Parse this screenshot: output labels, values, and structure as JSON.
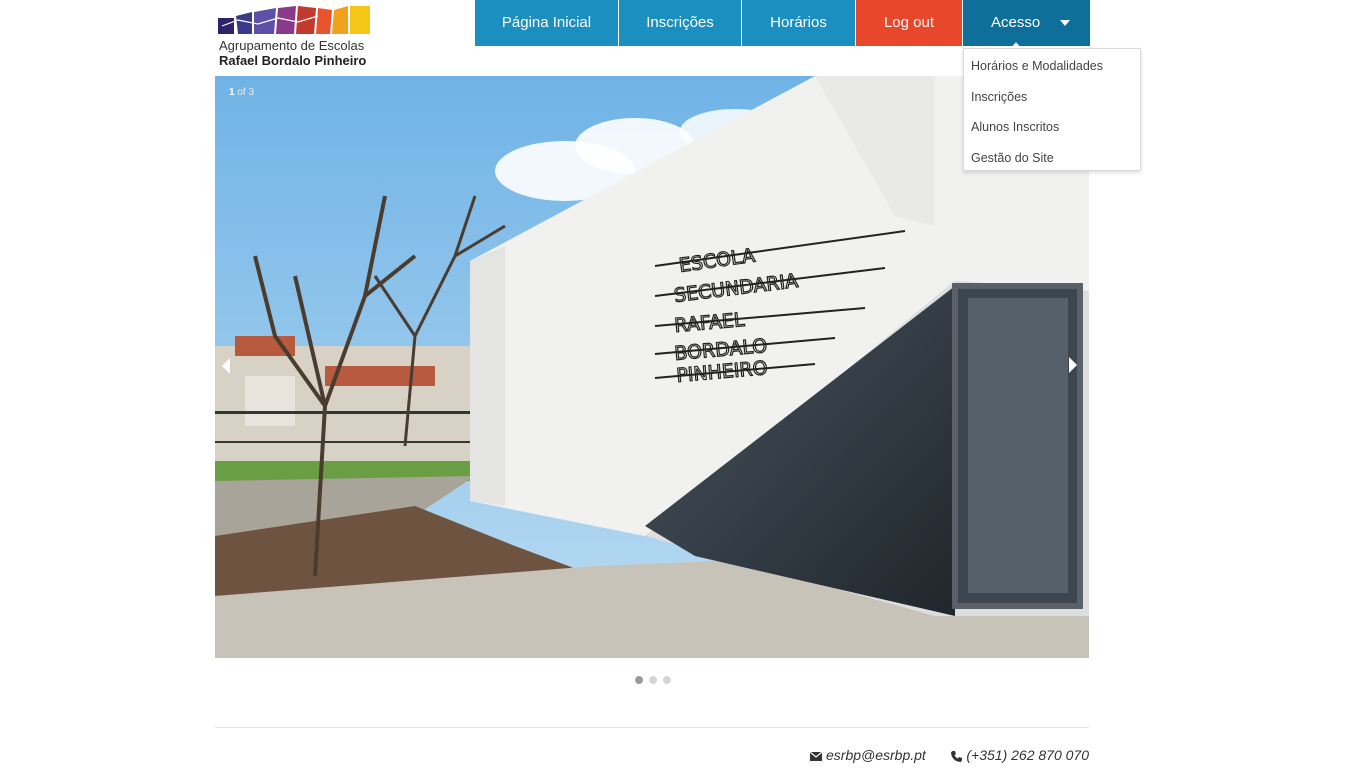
{
  "logo": {
    "line1": "Agrupamento de Escolas",
    "line2": "Rafael Bordalo Pinheiro",
    "colors": [
      "#2b2466",
      "#3a3a8c",
      "#5e4fa8",
      "#8a3a8a",
      "#c23a2e",
      "#e8542b",
      "#f0a21c",
      "#f5c518"
    ]
  },
  "nav": {
    "home": "Página Inicial",
    "inscricoes": "Inscrições",
    "horarios": "Horários",
    "logout": "Log out",
    "acesso": "Acesso"
  },
  "dropdown": {
    "items": [
      "Horários e Modalidades",
      "Inscrições",
      "Alunos Inscritos",
      "Gestão do Site"
    ]
  },
  "slider": {
    "current": "1",
    "of_label": "of",
    "total": "3",
    "wall_lettering": [
      "ESCOLA",
      "SECUNDARIA",
      "RAFAEL",
      "BORDALO",
      "PINHEIRO"
    ],
    "active_index": 0
  },
  "footer": {
    "email": "esrbp@esrbp.pt",
    "phone": "(+351) 262 870 070",
    "email_icon": "envelope-icon",
    "phone_icon": "phone-icon"
  },
  "colors": {
    "nav_blue": "#1a8fc0",
    "nav_active": "#0e6f9b",
    "logout_red": "#e8472b"
  }
}
